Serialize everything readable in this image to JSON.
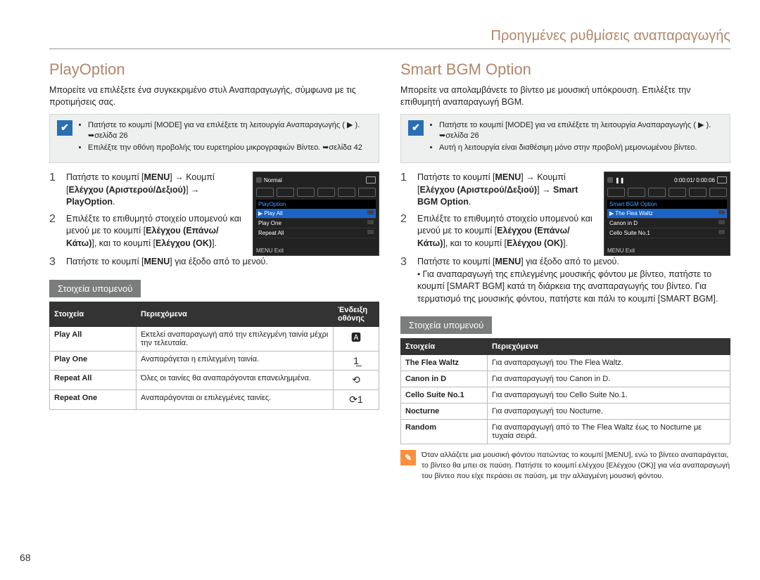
{
  "breadcrumb": "Προηγμένες ρυθμίσεις αναπαραγωγής",
  "page_number": "68",
  "left": {
    "heading": "PlayOption",
    "intro": "Μπορείτε να επιλέξετε ένα συγκεκριμένο στυλ Αναπαραγωγής, σύμφωνα με τις προτιμήσεις σας.",
    "note_items": [
      "Πατήστε το κουμπί [MODE] για να επιλέξετε τη λειτουργία Αναπαραγωγής ( ▶ ). ➥σελίδα 26",
      "Επιλέξτε την οθόνη προβολής του ευρετηρίου μικρογραφιών Βίντεο. ➥σελίδα 42"
    ],
    "steps": [
      "Πατήστε το κουμπί [MENU] → Κουμπί [Ελέγχου (Αριστερού/Δεξιού)] → PlayOption.",
      "Επιλέξτε το επιθυμητό στοιχείο υπομενού και μενού με το κουμπί [Ελέγχου (Επάνω/Κάτω)], και το κουμπί [Ελέγχου (OK)].",
      "Πατήστε το κουμπί [MENU] για έξοδο από το μενού."
    ],
    "submenu_title": "Στοιχεία υπομενού",
    "table": {
      "headers": [
        "Στοιχεία",
        "Περιεχόμενα",
        "Ένδειξη οθόνης"
      ],
      "rows": [
        {
          "item": "Play All",
          "desc": "Εκτελεί αναπαραγωγή από την επιλεγμένη ταινία μέχρι την τελευταία.",
          "icon": "🅰"
        },
        {
          "item": "Play One",
          "desc": "Αναπαράγεται η επιλεγμένη ταινία.",
          "icon": "1̲"
        },
        {
          "item": "Repeat All",
          "desc": "Όλες οι ταινίες θα αναπαράγονται επανειλημμένα.",
          "icon": "⟲"
        },
        {
          "item": "Repeat One",
          "desc": "Αναπαράγονται οι επιλεγμένες ταινίες.",
          "icon": "⟳1"
        }
      ]
    },
    "mini": {
      "normal": "Normal",
      "section": "PlayOption",
      "sel": "Play All",
      "opt2": "Play One",
      "opt3": "Repeat All",
      "exit": "MENU Exit"
    }
  },
  "right": {
    "heading": "Smart BGM Option",
    "intro": "Μπορείτε να απολαμβάνετε το βίντεο με μουσική υπόκρουση. Επιλέξτε την επιθυμητή αναπαραγωγή BGM.",
    "note_items": [
      "Πατήστε το κουμπί [MODE] για να επιλέξετε τη λειτουργία Αναπαραγωγής ( ▶ ). ➥σελίδα 26",
      "Αυτή η λειτουργία είναι διαθέσιμη μόνο στην προβολή μεμονωμένου βίντεο."
    ],
    "steps": [
      "Πατήστε το κουμπί [MENU] → Κουμπί [Ελέγχου (Αριστερού/Δεξιού)] → Smart BGM Option.",
      "Επιλέξτε το επιθυμητό στοιχείο υπομενού και μενού με το κουμπί [Ελέγχου (Επάνω/Κάτω)], και το κουμπί [Ελέγχου (OK)].",
      "Πατήστε το κουμπί [MENU] για έξοδο από το μενού."
    ],
    "bullet": "Για αναπαραγωγή της επιλεγμένης μουσικής φόντου με βίντεο, πατήστε το κουμπί [SMART BGM] κατά τη διάρκεια της αναπαραγωγής του βίντεο. Για τερματισμό της μουσικής φόντου, πατήστε και πάλι το κουμπί [SMART BGM].",
    "submenu_title": "Στοιχεία υπομενού",
    "table": {
      "headers": [
        "Στοιχεία",
        "Περιεχόμενα"
      ],
      "rows": [
        {
          "item": "The Flea Waltz",
          "desc": "Για αναπαραγωγή του The Flea Waltz."
        },
        {
          "item": "Canon in D",
          "desc": "Για αναπαραγωγή του Canon in D."
        },
        {
          "item": "Cello Suite No.1",
          "desc": "Για αναπαραγωγή του Cello Suite No.1."
        },
        {
          "item": "Nocturne",
          "desc": "Για αναπαραγωγή του Nocturne."
        },
        {
          "item": "Random",
          "desc": "Για αναπαραγωγή από το The Flea Waltz έως το Nocturne με τυχαία σειρά."
        }
      ]
    },
    "footnote": "Όταν αλλάζετε μια μουσική φόντου πατώντας το κουμπί [MENU], ενώ το βίντεο αναπαράγεται, το βίντεο θα μπει σε παύση. Πατήστε το κουμπί ελέγχου [Ελέγχου (OK)] για νέα αναπαραγωγή του βίντεο που είχε περάσει σε παύση, με την αλλαγμένη μουσική φόντου.",
    "mini": {
      "time": "0:00:01/ 0:00:06",
      "section": "Smart BGM Option",
      "sel": "The Flea Waltz",
      "opt2": "Canon in D",
      "opt3": "Cello Suite No.1",
      "exit": "MENU Exit"
    }
  }
}
